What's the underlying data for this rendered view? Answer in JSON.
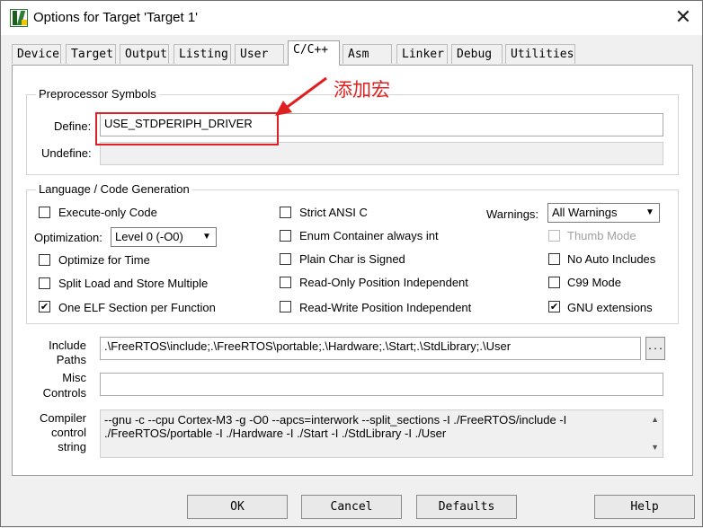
{
  "window": {
    "title": "Options for Target 'Target 1'",
    "close_glyph": "✕"
  },
  "tabs": [
    "Device",
    "Target",
    "Output",
    "Listing",
    "User",
    "C/C++",
    "Asm",
    "Linker",
    "Debug",
    "Utilities"
  ],
  "active_tab": "C/C++",
  "preprocessor": {
    "group_title": "Preprocessor Symbols",
    "define_label": "Define:",
    "define_value": "USE_STDPERIPH_DRIVER",
    "undefine_label": "Undefine:",
    "undefine_value": ""
  },
  "annotation": {
    "text": "添加宏",
    "color": "#e02020"
  },
  "language": {
    "group_title": "Language / Code Generation",
    "execute_only": {
      "label": "Execute-only Code",
      "checked": false
    },
    "optimization_label": "Optimization:",
    "optimization_value": "Level 0 (-O0)",
    "optimize_time": {
      "label": "Optimize for Time",
      "checked": false
    },
    "split_load": {
      "label": "Split Load and Store Multiple",
      "checked": false
    },
    "one_elf": {
      "label": "One ELF Section per Function",
      "checked": true
    },
    "strict_ansi": {
      "label": "Strict ANSI C",
      "checked": false
    },
    "enum_container": {
      "label": "Enum Container always int",
      "checked": false
    },
    "plain_char": {
      "label": "Plain Char is Signed",
      "checked": false
    },
    "ro_pos": {
      "label": "Read-Only Position Independent",
      "checked": false
    },
    "rw_pos": {
      "label": "Read-Write Position Independent",
      "checked": false
    },
    "warnings_label": "Warnings:",
    "warnings_value": "All Warnings",
    "thumb_mode": {
      "label": "Thumb Mode",
      "checked": false,
      "disabled": true
    },
    "no_auto_includes": {
      "label": "No Auto Includes",
      "checked": false
    },
    "c99_mode": {
      "label": "C99 Mode",
      "checked": false
    },
    "gnu_extensions": {
      "label": "GNU extensions",
      "checked": true
    }
  },
  "include": {
    "label_line1": "Include",
    "label_line2": "Paths",
    "value": ".\\FreeRTOS\\include;.\\FreeRTOS\\portable;.\\Hardware;.\\Start;.\\StdLibrary;.\\User",
    "browse_label": "..."
  },
  "misc": {
    "label_line1": "Misc",
    "label_line2": "Controls",
    "value": ""
  },
  "compiler": {
    "label_line1": "Compiler",
    "label_line2": "control",
    "label_line3": "string",
    "line1": "--gnu -c --cpu Cortex-M3 -g -O0 --apcs=interwork --split_sections -I ./FreeRTOS/include -I",
    "line2": "./FreeRTOS/portable -I ./Hardware -I ./Start -I ./StdLibrary -I ./User"
  },
  "buttons": {
    "ok": "OK",
    "cancel": "Cancel",
    "defaults": "Defaults",
    "help": "Help"
  }
}
